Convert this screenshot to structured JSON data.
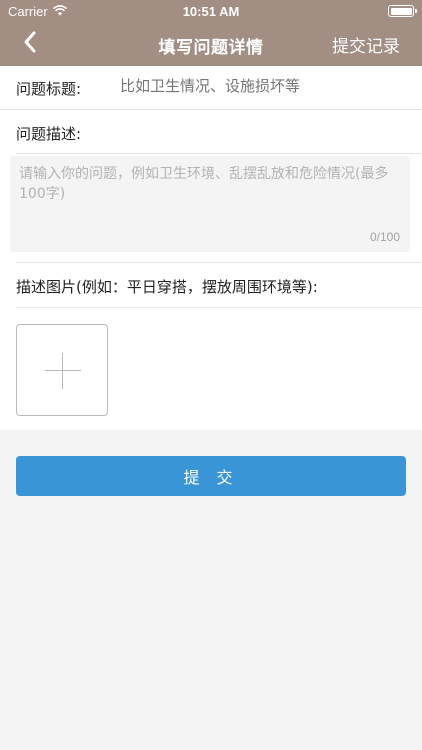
{
  "status_bar": {
    "carrier": "Carrier",
    "time": "10:51 AM",
    "wifi_icon": "wifi-icon",
    "battery_icon": "battery-icon"
  },
  "nav": {
    "back_icon": "chevron-left-icon",
    "title": "填写问题详情",
    "right_button": "提交记录"
  },
  "form": {
    "title_label": "问题标题:",
    "title_placeholder": "比如卫生情况、设施损坏等",
    "desc_label": "问题描述:",
    "desc_placeholder": "请输入你的问题，例如卫生环境、乱摆乱放和危险情况(最多100字)",
    "desc_counter": "0/100",
    "photo_label": "描述图片(例如：平日穿搭，摆放周围环境等):",
    "add_photo_icon": "plus-icon"
  },
  "submit_label": "提 交",
  "colors": {
    "nav_bg": "#a38e83",
    "submit_bg": "#3a95d7",
    "page_bg": "#f4f4f4"
  }
}
